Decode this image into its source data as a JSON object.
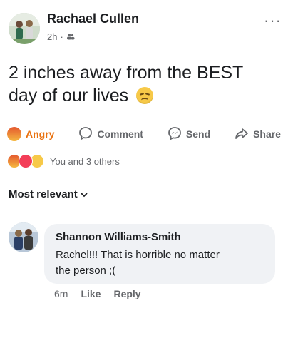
{
  "post": {
    "author": "Rachael Cullen",
    "time": "2h",
    "privacy_icon": "friends-icon",
    "more_label": "···",
    "text_line1": "2 inches away from the BEST",
    "text_line2": "day of our lives",
    "text_emoji": "sad-face-emoji"
  },
  "actions": {
    "angry_label": "Angry",
    "comment_label": "Comment",
    "send_label": "Send",
    "share_label": "Share"
  },
  "reactions": {
    "summary": "You and 3 others",
    "icons": [
      "angry-icon",
      "love-icon",
      "wow-icon"
    ]
  },
  "filter": {
    "label": "Most relevant"
  },
  "comment": {
    "author": "Shannon Williams-Smith",
    "text_line1": "Rachel!!! That is horrible no matter",
    "text_line2": "the person ;(",
    "time": "6m",
    "like_label": "Like",
    "reply_label": "Reply"
  },
  "colors": {
    "angry": "#e9710f",
    "secondary_text": "#65676b",
    "bubble": "#f0f2f5"
  }
}
